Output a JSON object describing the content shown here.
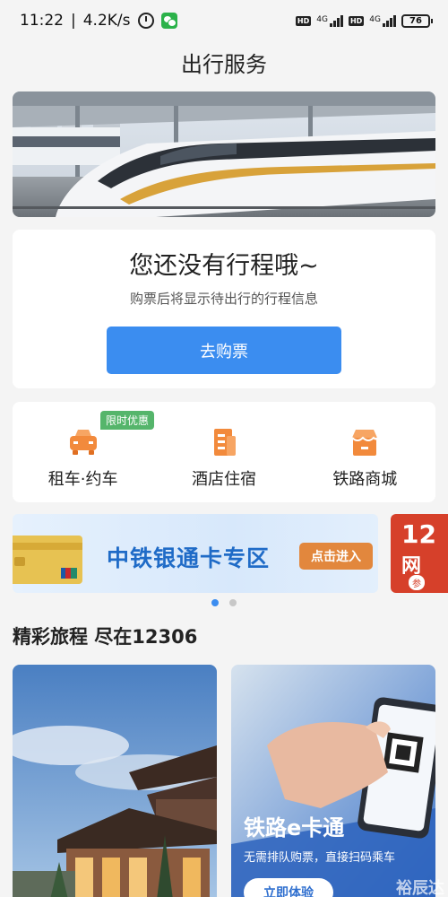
{
  "status_bar": {
    "time": "11:22",
    "speed": "4.2K/s",
    "net1_label": "4G",
    "net2_label": "4G",
    "hd": "HD",
    "battery": "76"
  },
  "page": {
    "title": "出行服务"
  },
  "trip": {
    "title": "您还没有行程哦~",
    "subtitle": "购票后将显示待出行的行程信息",
    "buy_button": "去购票"
  },
  "services": {
    "items": [
      {
        "label": "租车·约车",
        "icon": "car-icon",
        "color": "#f28a3c"
      },
      {
        "label": "酒店住宿",
        "icon": "hotel-icon",
        "color": "#f28a3c"
      },
      {
        "label": "铁路商城",
        "icon": "shop-icon",
        "color": "#f28a3c"
      }
    ],
    "promo_tag": "限时优惠"
  },
  "ad_banner": {
    "title": "中铁银通卡专区",
    "button": "点击进入",
    "next_number": "12",
    "next_text": "网",
    "next_badge": "参"
  },
  "carousel": {
    "count": 2,
    "active": 0
  },
  "section": {
    "title": "精彩旅程 尽在12306"
  },
  "features": [
    {
      "title": "",
      "subtitle": "",
      "button": ""
    },
    {
      "title": "铁路e卡通",
      "subtitle": "无需排队购票，直接扫码乘车",
      "button": "立即体验"
    }
  ],
  "watermark": "裕辰达",
  "colors": {
    "accent": "#3b8df0",
    "promo": "#55b56b",
    "orange": "#f28a3c",
    "ad_blue": "#1f6bc7"
  }
}
